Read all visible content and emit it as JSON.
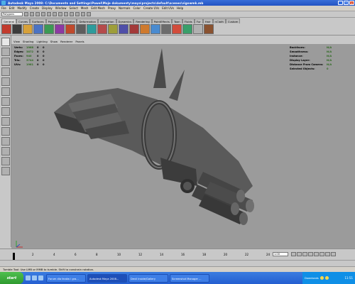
{
  "window": {
    "title": "Autodesk Maya 2008: C:\\Documents and Settings\\Pawel\\Moje dokumenty\\maya\\projects\\default\\scenes\\vigowmk.mb"
  },
  "menubar": {
    "items": [
      "File",
      "Edit",
      "Modify",
      "Create",
      "Display",
      "Window",
      "Select",
      "Mesh",
      "Edit Mesh",
      "Proxy",
      "Normals",
      "Color",
      "Create UVs",
      "Edit UVs",
      "Help"
    ]
  },
  "statusline": {
    "mode": "Polygons"
  },
  "shelf": {
    "tabs": [
      "General",
      "Curves",
      "Surfaces",
      "Polygons",
      "Subdivs",
      "Deformation",
      "Animation",
      "Dynamics",
      "Rendering",
      "PaintEffects",
      "Toon",
      "Fluids",
      "Fur",
      "Hair",
      "nCloth",
      "Custom"
    ],
    "active_tab": "General"
  },
  "panel": {
    "menus": [
      "View",
      "Shading",
      "Lighting",
      "Show",
      "Renderer",
      "Panels"
    ],
    "camera": "persp"
  },
  "hud_left": {
    "rows": [
      {
        "label": "Verts:",
        "values": [
          "1968",
          "0",
          "0"
        ]
      },
      {
        "label": "Edges:",
        "values": [
          "3872",
          "0",
          "0"
        ]
      },
      {
        "label": "Faces:",
        "values": [
          "940",
          "0",
          "0"
        ]
      },
      {
        "label": "Tris:",
        "values": [
          "3744",
          "0",
          "0"
        ]
      },
      {
        "label": "UVs:",
        "values": [
          "1981",
          "0",
          "0"
        ]
      }
    ]
  },
  "hud_right": {
    "rows": [
      {
        "label": "Backfaces:",
        "value": "N/A"
      },
      {
        "label": "Smoothness:",
        "value": "N/A"
      },
      {
        "label": "Instance:",
        "value": "N/A"
      },
      {
        "label": "Display Layer:",
        "value": "N/A"
      },
      {
        "label": "Distance From Camera:",
        "value": "N/A"
      },
      {
        "label": "Selected Objects:",
        "value": "0"
      }
    ]
  },
  "timeslider": {
    "ticks": [
      "2",
      "4",
      "6",
      "8",
      "10",
      "12",
      "14",
      "16",
      "18",
      "20",
      "22",
      "24"
    ],
    "current_frame": "1.00"
  },
  "rangeslider": {
    "start": "1.00",
    "end": "1.00"
  },
  "helpline": {
    "text": "Tumble Tool: Use LMB or MMB to tumble. Shift to constrain rotation."
  },
  "taskbar": {
    "start_label": "start",
    "tasks": [
      "Forum dla fanów i gra...",
      "Autodesk Maya 2008...",
      "Devil Inside/Gallery",
      "Screenshot Manager ..."
    ],
    "tray_label": "Downloads",
    "clock": "11:51"
  },
  "colors": {
    "viewport_bg": "#9b9b9b",
    "hud_value": "#2d6a1f",
    "titlebar": "#2454c2",
    "start_button": "#2f9a2f"
  }
}
